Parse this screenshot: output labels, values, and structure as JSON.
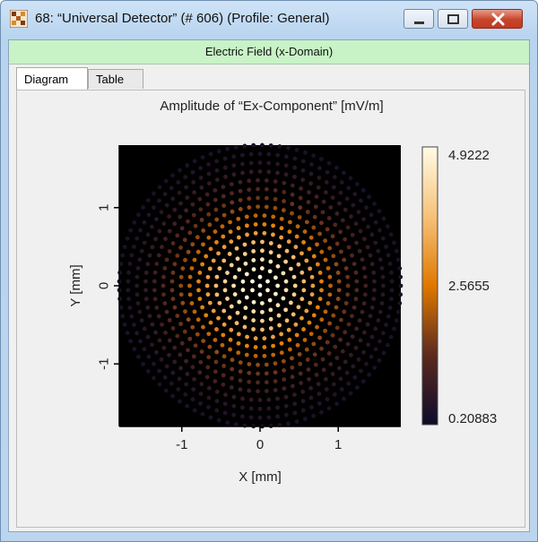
{
  "window": {
    "title": "68: “Universal Detector” (# 606) (Profile: General)",
    "icons": [
      "detector-app-icon",
      "minimize-icon",
      "maximize-icon",
      "close-icon"
    ]
  },
  "header": {
    "label": "Electric Field (x-Domain)",
    "color": "#c8f3c6"
  },
  "tabs": [
    {
      "label": "Diagram",
      "active": true
    },
    {
      "label": "Table",
      "active": false
    }
  ],
  "chart_data": {
    "type": "heatmap",
    "title": "Amplitude of “Ex-Component”  [mV/m]",
    "xlabel": "X [mm]",
    "ylabel": "Y [mm]",
    "xlim": [
      -1.8,
      1.8
    ],
    "ylim": [
      -1.8,
      1.8
    ],
    "xticks": [
      -1,
      0,
      1
    ],
    "yticks": [
      -1,
      0,
      1
    ],
    "colorbar": {
      "min": 0.20883,
      "mid": 2.5655,
      "max": 4.9222,
      "labels": [
        "4.9222",
        "2.5655",
        "0.20883"
      ],
      "colors": [
        "#0d0b2c",
        "#e07800",
        "#fffbe6"
      ]
    },
    "background": "#000000",
    "field": {
      "shape": "circular spot array",
      "radius_mm": 1.8,
      "peak_value": 4.9222,
      "edge_value": 0.20883,
      "rings": 16
    }
  }
}
